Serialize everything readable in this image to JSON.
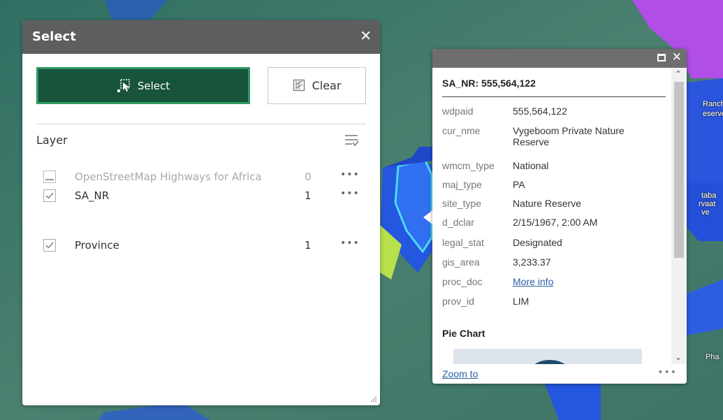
{
  "map": {
    "labels": {
      "ranch": "Ranch",
      "reserve": "eserve",
      "taba": "taba",
      "rvaat": "rvaat",
      "ve": "ve",
      "pha": "Pha"
    }
  },
  "select_panel": {
    "title": "Select",
    "close_glyph": "✕",
    "select_label": "Select",
    "clear_label": "Clear",
    "layer_header": "Layer",
    "layers": [
      {
        "name": "OpenStreetMap Highways for Africa",
        "count": "0",
        "checked": false,
        "disabled": true
      },
      {
        "name": "SA_NR",
        "count": "1",
        "checked": true,
        "disabled": false
      },
      {
        "name": "Province",
        "count": "1",
        "checked": true,
        "disabled": false
      }
    ],
    "menu_glyph": "•••"
  },
  "popup": {
    "close_glyph": "✕",
    "title": "SA_NR: 555,564,122",
    "attributes": [
      {
        "key": "wdpaid",
        "value": "555,564,122"
      },
      {
        "key": "cur_nme",
        "value": "Vygeboom Private Nature Reserve"
      },
      {
        "key": "wmcm_type",
        "value": "National"
      },
      {
        "key": "maj_type",
        "value": "PA"
      },
      {
        "key": "site_type",
        "value": "Nature Reserve"
      },
      {
        "key": "d_dclar",
        "value": "2/15/1967, 2:00 AM"
      },
      {
        "key": "legal_stat",
        "value": "Designated"
      },
      {
        "key": "gis_area",
        "value": "3,233.37"
      },
      {
        "key": "proc_doc",
        "value": "More info"
      },
      {
        "key": "prov_id",
        "value": "LIM"
      }
    ],
    "pie_chart_heading": "Pie Chart",
    "zoom_to": "Zoom to",
    "more_glyph": "•••",
    "scroll_up_glyph": "⌃",
    "scroll_down_glyph": "⌄"
  },
  "colors": {
    "map_green": "#3f7a6c",
    "select_header": "#5e5e5e",
    "select_button": "#17543b",
    "select_button_border": "#2f9a62",
    "popup_header": "#6e6e6e",
    "link": "#2a5ea6",
    "reserve_blue": "#2456e0",
    "province_purple": "#b04ee6",
    "highlight_cyan": "#4cd9f2",
    "yellow_green": "#b7e04a"
  }
}
